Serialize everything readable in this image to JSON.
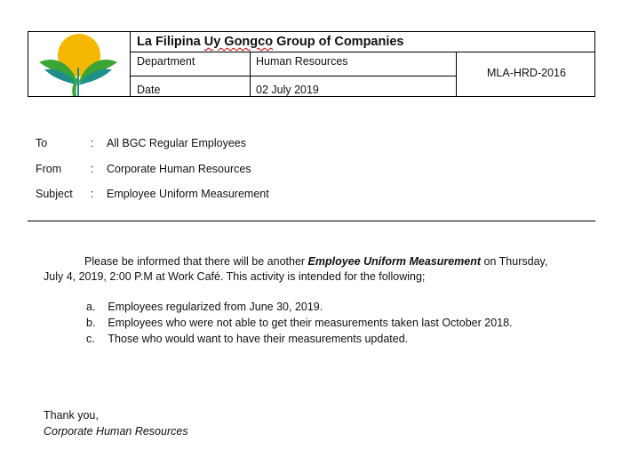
{
  "header": {
    "company": "La Filipina Uy Gongco Group of Companies",
    "company_pre": "La Filipina ",
    "company_squiggle": "Uy Gongco",
    "company_post": " Group of Companies",
    "department_label": "Department",
    "department_value": "Human Resources",
    "date_label": "Date",
    "date_value": "02 July 2019",
    "reference": "MLA-HRD-2016"
  },
  "memo": {
    "to_label": "To",
    "to_value": "All BGC Regular Employees",
    "from_label": "From",
    "from_value": "Corporate Human Resources",
    "subject_label": "Subject",
    "subject_value": "Employee Uniform Measurement",
    "colon": ":"
  },
  "body": {
    "p1_start": "Please be informed that there will be another ",
    "p1_emph": "Employee Uniform Measurement",
    "p1_end": " on Thursday,",
    "p1_line2": "July 4, 2019, 2:00 P.M at Work Café. This activity is intended for the following;",
    "items": [
      {
        "letter": "a.",
        "text": "Employees regularized from June 30, 2019."
      },
      {
        "letter": "b.",
        "text": "Employees who were not able to get their measurements taken last October 2018."
      },
      {
        "letter": "c.",
        "text": "Those who would want to have their measurements updated."
      }
    ]
  },
  "closing": {
    "thanks": "Thank you,",
    "signature": "Corporate Human Resources"
  },
  "colors": {
    "logo_sun": "#f5b800",
    "logo_leaf_green": "#3aa535",
    "logo_leaf_teal": "#1f8f8a",
    "squiggle": "#cc0000"
  }
}
